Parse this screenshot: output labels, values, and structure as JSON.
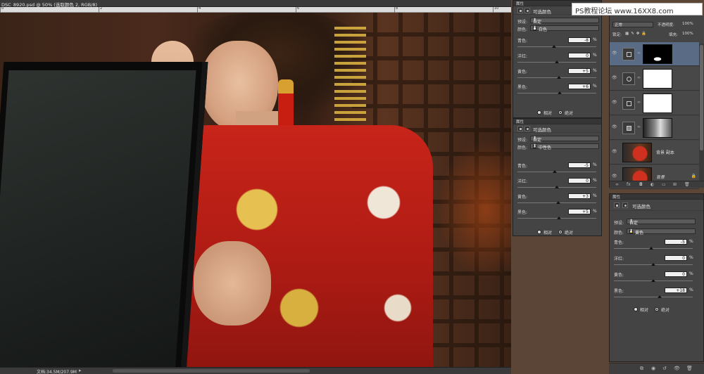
{
  "document": {
    "tab_title": "DSC_8920.psd @ 50% (选取颜色 2, RGB/8)",
    "status_text": "文档:34.5M/207.9M",
    "ruler_numbers": [
      "0",
      "2",
      "4",
      "6",
      "8",
      "10"
    ]
  },
  "watermark": {
    "text": "PS教程论坛 www.16XX8.com"
  },
  "panels": [
    {
      "header": "属性",
      "title": "可选颜色",
      "preset_label": "预设:",
      "preset_value": "自定",
      "color_label": "颜色:",
      "color_value": "白色",
      "swatch_color": "#ffffff",
      "sliders": [
        {
          "label": "青色:",
          "value": "-8"
        },
        {
          "label": "洋红:",
          "value": "0"
        },
        {
          "label": "黄色:",
          "value": "+5"
        },
        {
          "label": "黑色:",
          "value": "+6"
        }
      ],
      "radio_relative": "相对",
      "radio_absolute": "绝对",
      "selected": "absolute"
    },
    {
      "header": "属性",
      "title": "可选颜色",
      "preset_label": "预设:",
      "preset_value": "自定",
      "color_label": "颜色:",
      "color_value": "中性色",
      "swatch_color": "#808080",
      "sliders": [
        {
          "label": "青色:",
          "value": "-5"
        },
        {
          "label": "洋红:",
          "value": "0"
        },
        {
          "label": "黄色:",
          "value": "+3"
        },
        {
          "label": "黑色:",
          "value": "+5"
        }
      ],
      "radio_relative": "相对",
      "radio_absolute": "绝对",
      "selected": "absolute"
    },
    {
      "header": "属性",
      "title": "可选颜色",
      "preset_label": "预设:",
      "preset_value": "自定",
      "color_label": "颜色:",
      "color_value": "黄色",
      "swatch_color": "#ffe000",
      "sliders": [
        {
          "label": "青色:",
          "value": "-5"
        },
        {
          "label": "洋红:",
          "value": "0"
        },
        {
          "label": "黄色:",
          "value": "0"
        },
        {
          "label": "黑色:",
          "value": "+18"
        }
      ],
      "radio_relative": "相对",
      "radio_absolute": "绝对",
      "selected": "absolute"
    }
  ],
  "layers": {
    "blend_mode": "正常",
    "opacity_label": "不透明度:",
    "opacity_value": "100%",
    "lock_label": "锁定:",
    "fill_label": "填充:",
    "fill_value": "100%",
    "items": [
      {
        "name": "",
        "kind": "adjustment",
        "mask": "black",
        "active": true
      },
      {
        "name": "",
        "kind": "adjustment",
        "mask": "white",
        "active": false
      },
      {
        "name": "",
        "kind": "adjustment",
        "mask": "white",
        "active": false
      },
      {
        "name": "",
        "kind": "adjustment",
        "mask": "bw",
        "active": false
      },
      {
        "name": "背景 副本",
        "kind": "photo",
        "active": false
      },
      {
        "name": "背景",
        "kind": "photo",
        "active": false,
        "locked": true
      }
    ]
  },
  "icons": [
    "eye-icon",
    "link-icon",
    "lock-icon",
    "adjustment-icon",
    "mask-icon",
    "trash-icon"
  ]
}
